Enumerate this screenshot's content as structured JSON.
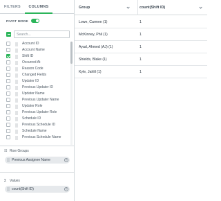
{
  "tabs": [
    {
      "label": "FILTERS",
      "active": false
    },
    {
      "label": "COLUMNS",
      "active": true
    }
  ],
  "pivot": {
    "label": "PIVOT MODE",
    "on": true
  },
  "search": {
    "placeholder": "Search...",
    "value": ""
  },
  "columns": [
    {
      "label": "Account ID",
      "checked": false
    },
    {
      "label": "Account Name",
      "checked": false
    },
    {
      "label": "Shift ID",
      "checked": true
    },
    {
      "label": "Occurred At",
      "checked": false
    },
    {
      "label": "Reason Code",
      "checked": false
    },
    {
      "label": "Changed Fields",
      "checked": false
    },
    {
      "label": "Updater ID",
      "checked": false
    },
    {
      "label": "Previous Updater ID",
      "checked": false
    },
    {
      "label": "Updater Name",
      "checked": false
    },
    {
      "label": "Previous Updater Name",
      "checked": false
    },
    {
      "label": "Updater Role",
      "checked": false
    },
    {
      "label": "Previous Updater Role",
      "checked": false
    },
    {
      "label": "Schedule ID",
      "checked": false
    },
    {
      "label": "Previous Schedule ID",
      "checked": false
    },
    {
      "label": "Schedule Name",
      "checked": false
    },
    {
      "label": "Previous Schedule Name",
      "checked": false
    }
  ],
  "row_groups": {
    "title": "Row Groups",
    "icon": "row-groups-icon",
    "items": [
      {
        "label": "Previous Assignee Name"
      }
    ]
  },
  "values_section": {
    "title": "Values",
    "icon": "sigma-icon",
    "items": [
      {
        "label": "count(Shift ID)"
      }
    ]
  },
  "grid": {
    "headers": {
      "group": "Group",
      "count": "count(Shift ID)"
    },
    "rows": [
      {
        "group": "Lowe, Carmen (1)",
        "count": "1"
      },
      {
        "group": "McKinney, Phil (1)",
        "count": "1"
      },
      {
        "group": "Ayad, Ahmed (AJ) (1)",
        "count": "1"
      },
      {
        "group": "Shields, Blake (1)",
        "count": "1"
      },
      {
        "group": "Kyle, Jahlil (1)",
        "count": "1"
      }
    ]
  },
  "colors": {
    "accent": "#2bb55a",
    "border": "#d3d8dc",
    "pill": "#e6e9ec"
  }
}
